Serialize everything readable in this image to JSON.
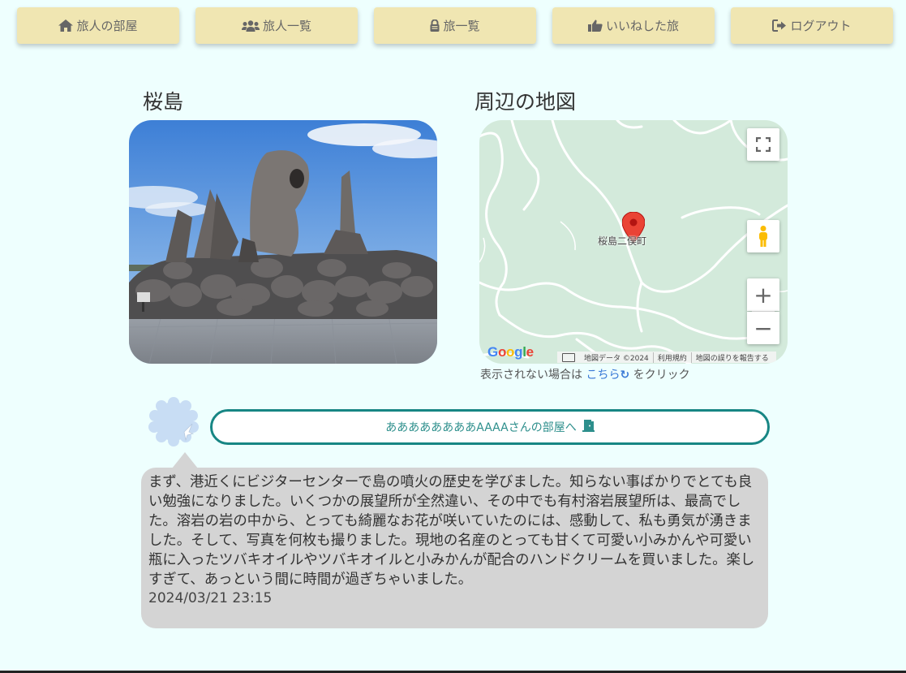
{
  "nav": [
    {
      "icon": "home-icon",
      "label": "旅人の部屋"
    },
    {
      "icon": "users-icon",
      "label": "旅人一覧"
    },
    {
      "icon": "lock-icon",
      "label": "旅一覧"
    },
    {
      "icon": "thumbs-up-icon",
      "label": "いいねした旅"
    },
    {
      "icon": "logout-icon",
      "label": "ログアウト"
    }
  ],
  "post": {
    "title": "桜島",
    "map_title": "周辺の地図",
    "map": {
      "place_label": "桜島二俣町",
      "attribution": [
        "地図データ ©2024",
        "利用規約",
        "地図の誤りを報告する"
      ]
    },
    "map_note": {
      "before": "表示されない場合は",
      "link": "こちら",
      "after": "をクリック"
    },
    "user_link": "ああああああああAAAAさんの部屋へ",
    "body": "まず、港近くにビジターセンターで島の噴火の歴史を学びました。知らない事ばかりでとても良い勉強になりました。いくつかの展望所が全然違い、その中でも有村溶岩展望所は、最高でした。溶岩の岩の中から、とっても綺麗なお花が咲いていたのには、感動して、私も勇気が湧きました。そして、写真を何枚も撮りました。現地の名産のとっても甘くて可愛い小みかんや可愛い瓶に入ったツバキオイルやツバキオイルと小みかんが配合のハンドクリームを買いました。楽しすぎて、あっという間に時間が過ぎちゃいました。",
    "datetime": "2024/03/21 23:15"
  }
}
